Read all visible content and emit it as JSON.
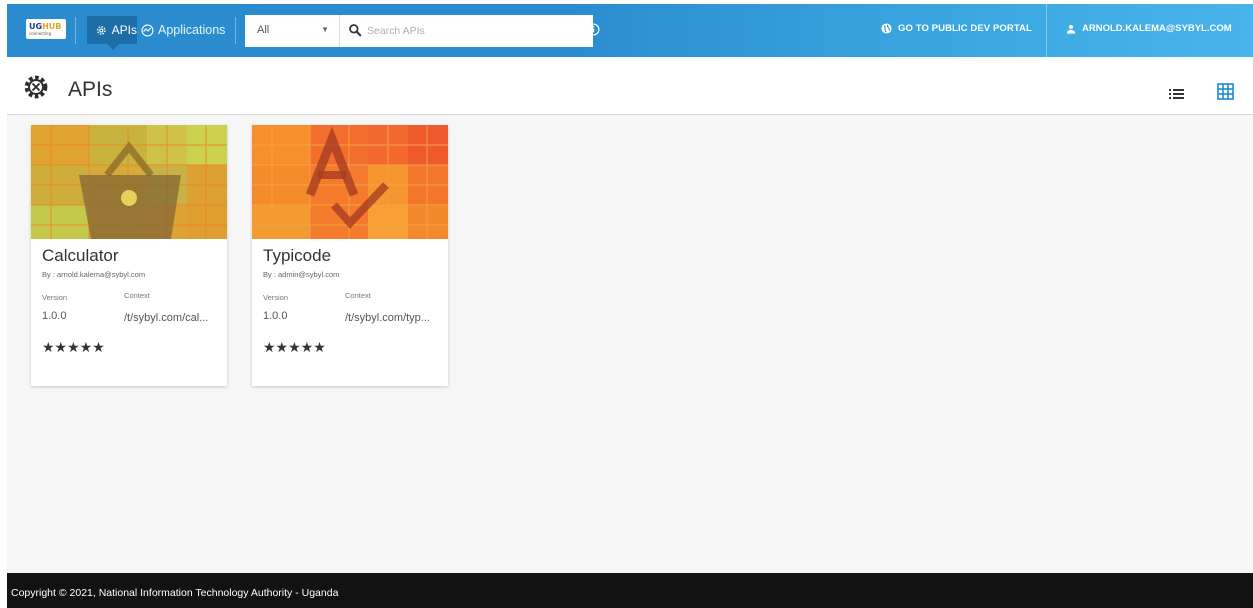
{
  "header": {
    "logo": {
      "main": "UG",
      "accent": "HUB",
      "sub": "connecting"
    },
    "nav": {
      "apis_label": "APIs",
      "applications_label": "Applications"
    },
    "search": {
      "filter_value": "All",
      "placeholder": "Search APIs"
    },
    "public_portal_label": "GO TO PUBLIC DEV PORTAL",
    "user_label": "ARNOLD.KALEMA@SYBYL.COM",
    "icons": [
      "gear-icon",
      "applications-icon",
      "search-icon",
      "info-icon",
      "globe-icon",
      "user-icon"
    ]
  },
  "page": {
    "title": "APIs",
    "view_modes": [
      "list-view-icon",
      "grid-view-icon"
    ],
    "active_view": "grid"
  },
  "cards": [
    {
      "name": "Calculator",
      "by": "By : arnold.kalema@sybyl.com",
      "version_label": "Version",
      "version": "1.0.0",
      "context_label": "Context",
      "context": "/t/sybyl.com/cal...",
      "rating": 5,
      "stars": "★★★★★",
      "thumbnail_icon": "basket-icon",
      "thumbnail_colors": [
        "#d7b13b",
        "#c2c84e",
        "#e8a22c",
        "#c9a23a"
      ]
    },
    {
      "name": "Typicode",
      "by": "By : admin@sybyl.com",
      "version_label": "Version",
      "version": "1.0.0",
      "context_label": "Context",
      "context": "/t/sybyl.com/typ...",
      "rating": 5,
      "stars": "★★★★★",
      "thumbnail_icon": "spellcheck-icon",
      "thumbnail_colors": [
        "#f56d2b",
        "#f7922a",
        "#f4a03a",
        "#ef5a2a"
      ]
    }
  ],
  "footer": {
    "copyright": "Copyright © 2021, National Information Technology Authority - Uganda"
  }
}
